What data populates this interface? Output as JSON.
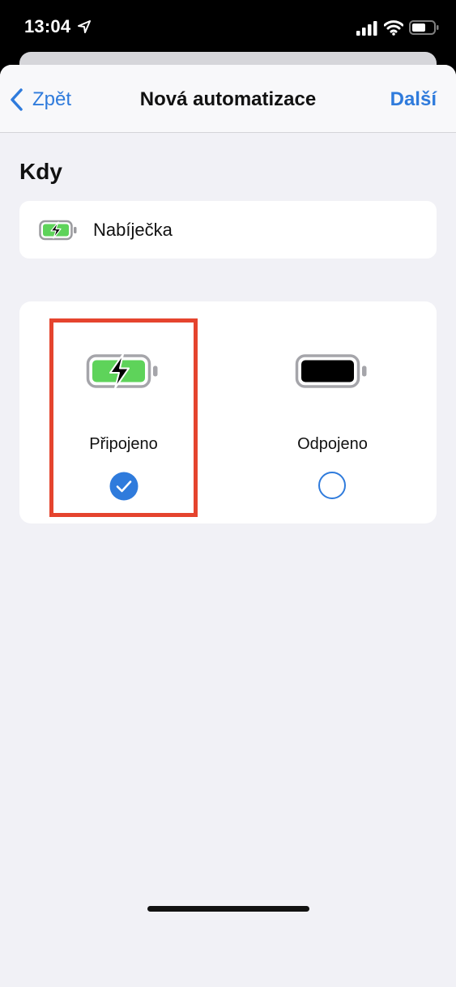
{
  "status_bar": {
    "time": "13:04"
  },
  "navbar": {
    "back_label": "Zpět",
    "title": "Nová automatizace",
    "next_label": "Další"
  },
  "section": {
    "title": "Kdy"
  },
  "trigger": {
    "label": "Nabíječka"
  },
  "options": [
    {
      "label": "Připojeno",
      "selected": true
    },
    {
      "label": "Odpojeno",
      "selected": false
    }
  ],
  "colors": {
    "accent": "#2f7bdc",
    "battery_green": "#5ed35a",
    "highlight": "#e5442e",
    "background": "#f1f1f6"
  },
  "icons": [
    "location-arrow-icon",
    "signal-icon",
    "wifi-icon",
    "battery-icon",
    "chevron-left-icon",
    "battery-charging-icon",
    "battery-full-icon",
    "checkmark-circle-icon",
    "empty-circle-icon"
  ]
}
